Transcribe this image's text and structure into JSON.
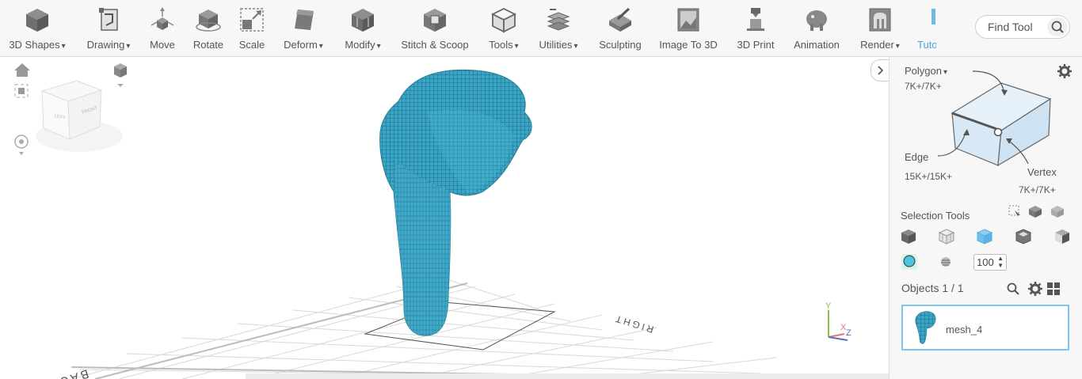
{
  "toolbar": {
    "tools": [
      {
        "label": "3D Shapes",
        "icon": "cube-icon",
        "dropdown": true
      },
      {
        "label": "Drawing",
        "icon": "drawing-icon",
        "dropdown": true
      },
      {
        "label": "Move",
        "icon": "move-icon",
        "dropdown": false
      },
      {
        "label": "Rotate",
        "icon": "rotate-icon",
        "dropdown": false
      },
      {
        "label": "Scale",
        "icon": "scale-icon",
        "dropdown": false
      },
      {
        "label": "Deform",
        "icon": "deform-icon",
        "dropdown": true
      },
      {
        "label": "Modify",
        "icon": "modify-icon",
        "dropdown": true
      },
      {
        "label": "Stitch & Scoop",
        "icon": "stitch-scoop-icon",
        "dropdown": false
      },
      {
        "label": "Tools",
        "icon": "tools-icon",
        "dropdown": true
      },
      {
        "label": "Utilities",
        "icon": "utilities-icon",
        "dropdown": true
      },
      {
        "label": "Sculpting",
        "icon": "sculpting-icon",
        "dropdown": false
      },
      {
        "label": "Image To 3D",
        "icon": "image-to-3d-icon",
        "dropdown": false
      },
      {
        "label": "3D Print",
        "icon": "3d-print-icon",
        "dropdown": false
      },
      {
        "label": "Animation",
        "icon": "animation-icon",
        "dropdown": false
      },
      {
        "label": "Render",
        "icon": "render-icon",
        "dropdown": true
      },
      {
        "label": "Tuto",
        "icon": "tutorial-icon",
        "dropdown": false
      }
    ],
    "find_tool": {
      "label": "Find Tool"
    }
  },
  "viewport": {
    "view_cube": {
      "left_face": "LEFT",
      "front_face": "FRONT"
    },
    "grid_labels": {
      "back": "BACK",
      "right": "RIGHT"
    },
    "axis": {
      "y": "Y",
      "x": "X",
      "z": "Z"
    },
    "mesh_color": "#3aa6c7"
  },
  "panel": {
    "polygon": {
      "label": "Polygon",
      "count": "7K+/7K+"
    },
    "edge": {
      "label": "Edge",
      "count": "15K+/15K+"
    },
    "vertex": {
      "label": "Vertex",
      "count": "7K+/7K+"
    },
    "selection_tools_label": "Selection Tools",
    "brush_size": "100",
    "objects": {
      "label": "Objects 1 / 1"
    },
    "object_list": [
      {
        "name": "mesh_4"
      }
    ]
  },
  "colors": {
    "accent": "#4aa3df",
    "selection_highlight": "#7cc4ec",
    "mesh": "#3aa6c7"
  }
}
